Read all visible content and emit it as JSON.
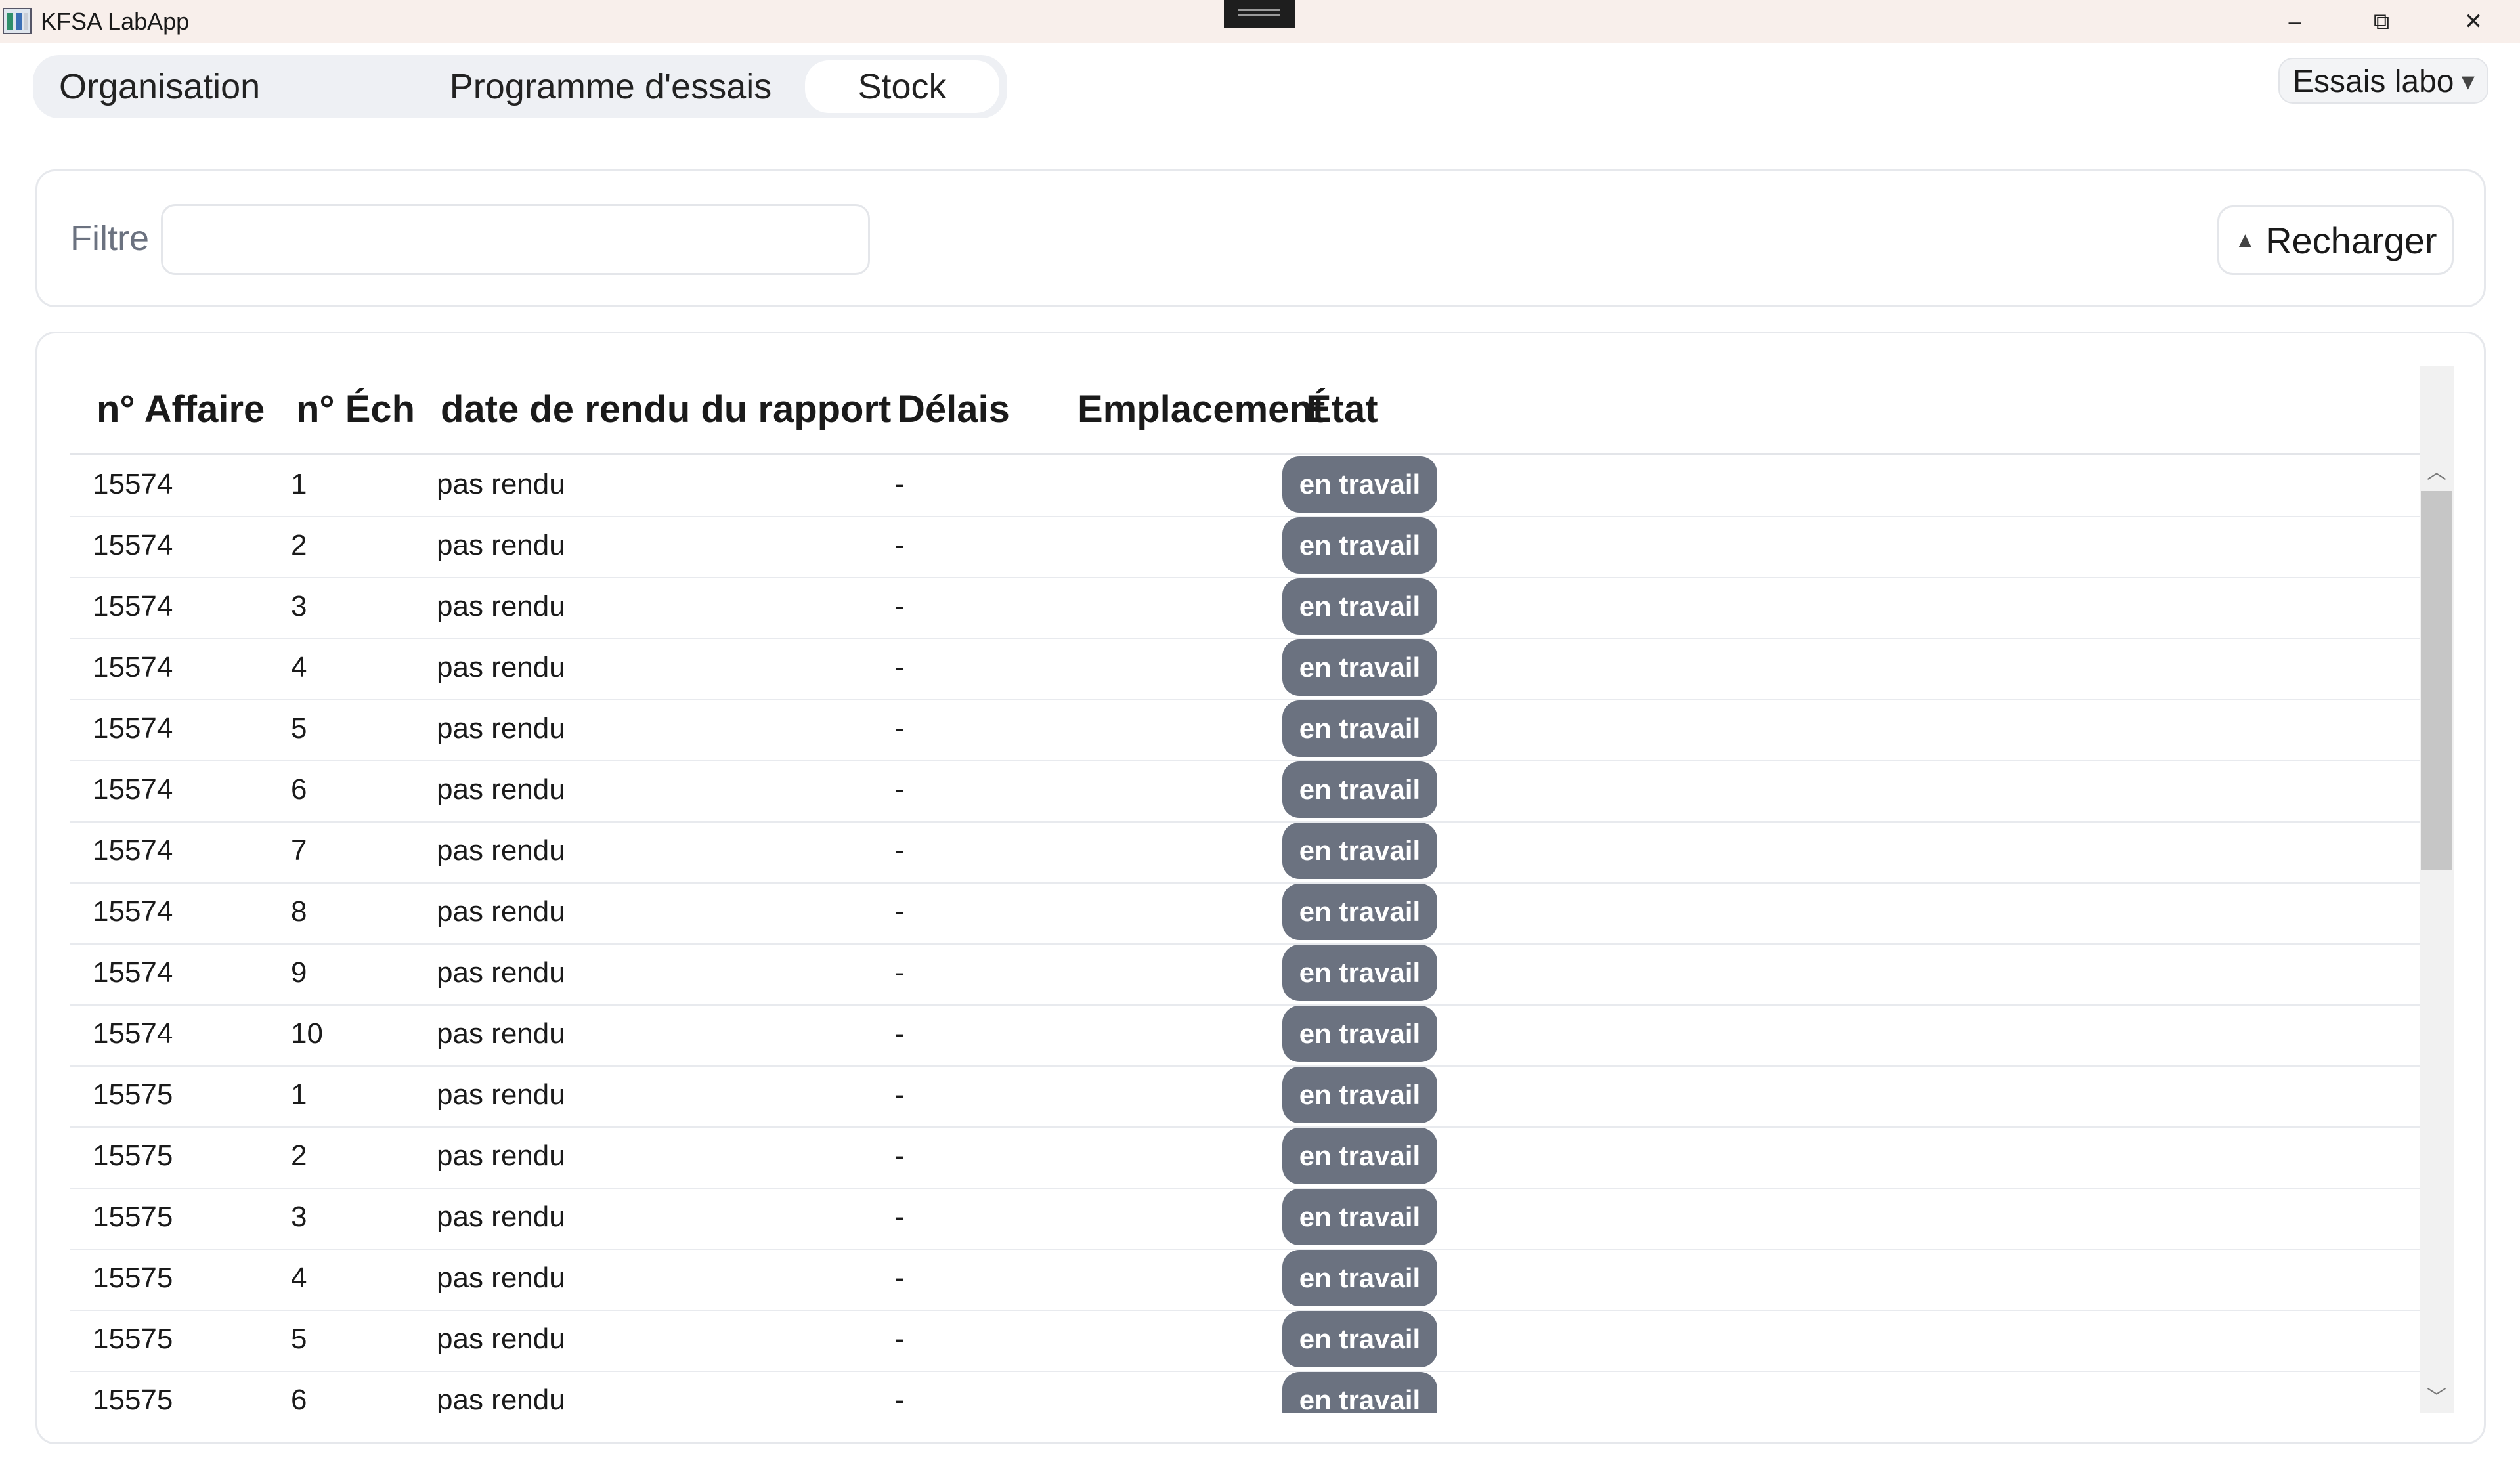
{
  "window": {
    "title": "KFSA LabApp",
    "controls": {
      "minimize": "–",
      "maximize": "⧉",
      "close": "✕"
    }
  },
  "tabs": [
    {
      "label": "Organisation",
      "selected": false
    },
    {
      "label": "Programme d'essais",
      "selected": false
    },
    {
      "label": "Stock",
      "selected": true
    }
  ],
  "mode_select": {
    "value": "Essais labo",
    "caret": "▼"
  },
  "filter": {
    "label": "Filtre",
    "value": "",
    "placeholder": ""
  },
  "reload_button": {
    "icon": "triangle-up-icon",
    "glyph": "▲",
    "label": "Recharger"
  },
  "table": {
    "columns": [
      "n° Affaire",
      "n° Éch",
      "date de rendu du rapport",
      "Délais",
      "Emplacement",
      "État"
    ],
    "rows": [
      {
        "affaire": "15574",
        "ech": "1",
        "date": "pas rendu",
        "delais": "-",
        "emplacement": "",
        "etat": "en travail"
      },
      {
        "affaire": "15574",
        "ech": "2",
        "date": "pas rendu",
        "delais": "-",
        "emplacement": "",
        "etat": "en travail"
      },
      {
        "affaire": "15574",
        "ech": "3",
        "date": "pas rendu",
        "delais": "-",
        "emplacement": "",
        "etat": "en travail"
      },
      {
        "affaire": "15574",
        "ech": "4",
        "date": "pas rendu",
        "delais": "-",
        "emplacement": "",
        "etat": "en travail"
      },
      {
        "affaire": "15574",
        "ech": "5",
        "date": "pas rendu",
        "delais": "-",
        "emplacement": "",
        "etat": "en travail"
      },
      {
        "affaire": "15574",
        "ech": "6",
        "date": "pas rendu",
        "delais": "-",
        "emplacement": "",
        "etat": "en travail"
      },
      {
        "affaire": "15574",
        "ech": "7",
        "date": "pas rendu",
        "delais": "-",
        "emplacement": "",
        "etat": "en travail"
      },
      {
        "affaire": "15574",
        "ech": "8",
        "date": "pas rendu",
        "delais": "-",
        "emplacement": "",
        "etat": "en travail"
      },
      {
        "affaire": "15574",
        "ech": "9",
        "date": "pas rendu",
        "delais": "-",
        "emplacement": "",
        "etat": "en travail"
      },
      {
        "affaire": "15574",
        "ech": "10",
        "date": "pas rendu",
        "delais": "-",
        "emplacement": "",
        "etat": "en travail"
      },
      {
        "affaire": "15575",
        "ech": "1",
        "date": "pas rendu",
        "delais": "-",
        "emplacement": "",
        "etat": "en travail"
      },
      {
        "affaire": "15575",
        "ech": "2",
        "date": "pas rendu",
        "delais": "-",
        "emplacement": "",
        "etat": "en travail"
      },
      {
        "affaire": "15575",
        "ech": "3",
        "date": "pas rendu",
        "delais": "-",
        "emplacement": "",
        "etat": "en travail"
      },
      {
        "affaire": "15575",
        "ech": "4",
        "date": "pas rendu",
        "delais": "-",
        "emplacement": "",
        "etat": "en travail"
      },
      {
        "affaire": "15575",
        "ech": "5",
        "date": "pas rendu",
        "delais": "-",
        "emplacement": "",
        "etat": "en travail"
      },
      {
        "affaire": "15575",
        "ech": "6",
        "date": "pas rendu",
        "delais": "-",
        "emplacement": "",
        "etat": "en travail"
      }
    ]
  },
  "scrollbar": {
    "up": "︿",
    "down": "﹀"
  },
  "colors": {
    "titlebar": "#f8efeb",
    "tabbar": "#eef0f4",
    "badge": "#6b7280",
    "badge_text": "#ffffff"
  }
}
